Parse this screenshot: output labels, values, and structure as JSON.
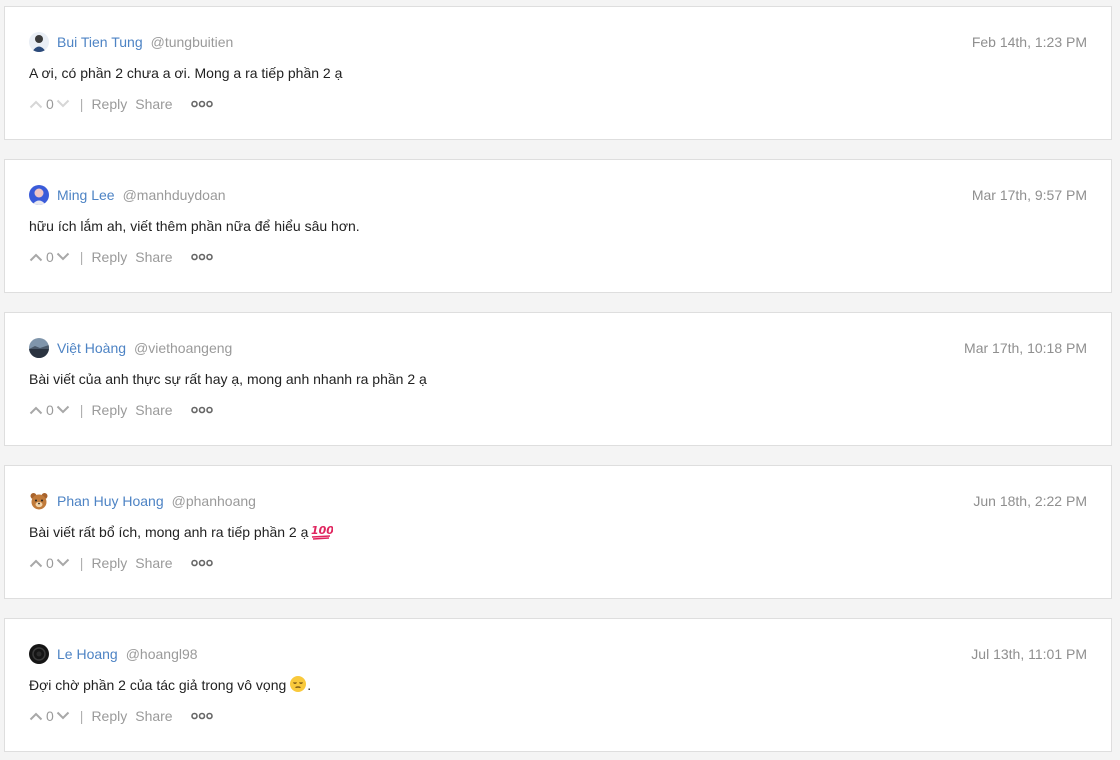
{
  "comments": [
    {
      "name": "Bui Tien Tung",
      "handle": "@tungbuitien",
      "time": "Feb 14th, 1:23 PM",
      "text": "A ơi, có phần 2 chưa a ơi. Mong a ra tiếp phần 2 ạ",
      "votes": "0",
      "reply": "Reply",
      "share": "Share",
      "emoji": ""
    },
    {
      "name": "Ming Lee",
      "handle": "@manhduydoan",
      "time": "Mar 17th, 9:57 PM",
      "text": "hữu ích lắm ah, viết thêm phần nữa để hiểu sâu hơn.",
      "votes": "0",
      "reply": "Reply",
      "share": "Share",
      "emoji": ""
    },
    {
      "name": "Việt Hoàng",
      "handle": "@viethoangeng",
      "time": "Mar 17th, 10:18 PM",
      "text": "Bài viết của anh thực sự rất hay ạ, mong anh nhanh ra phần 2 ạ",
      "votes": "0",
      "reply": "Reply",
      "share": "Share",
      "emoji": ""
    },
    {
      "name": "Phan Huy Hoang",
      "handle": "@phanhoang",
      "time": "Jun 18th, 2:22 PM",
      "text": "Bài viết rất bổ ích, mong anh ra tiếp phần 2 ạ",
      "votes": "0",
      "reply": "Reply",
      "share": "Share",
      "emoji": "hundred-points-emoji"
    },
    {
      "name": "Le Hoang",
      "handle": "@hoangl98",
      "time": "Jul 13th, 11:01 PM",
      "text": "Đợi chờ phần 2 của tác giả trong vô vọng",
      "text_after": ".",
      "votes": "0",
      "reply": "Reply",
      "share": "Share",
      "emoji": "pensive-face-emoji"
    }
  ],
  "colors": {
    "name_link": "#4d83c4",
    "muted": "#9a9a9a",
    "card_bg": "#ffffff",
    "page_bg": "#f4f4f4"
  },
  "icons": {
    "upvote": "chevron-up-icon",
    "downvote": "chevron-down-icon",
    "more": "more-dots-icon"
  }
}
